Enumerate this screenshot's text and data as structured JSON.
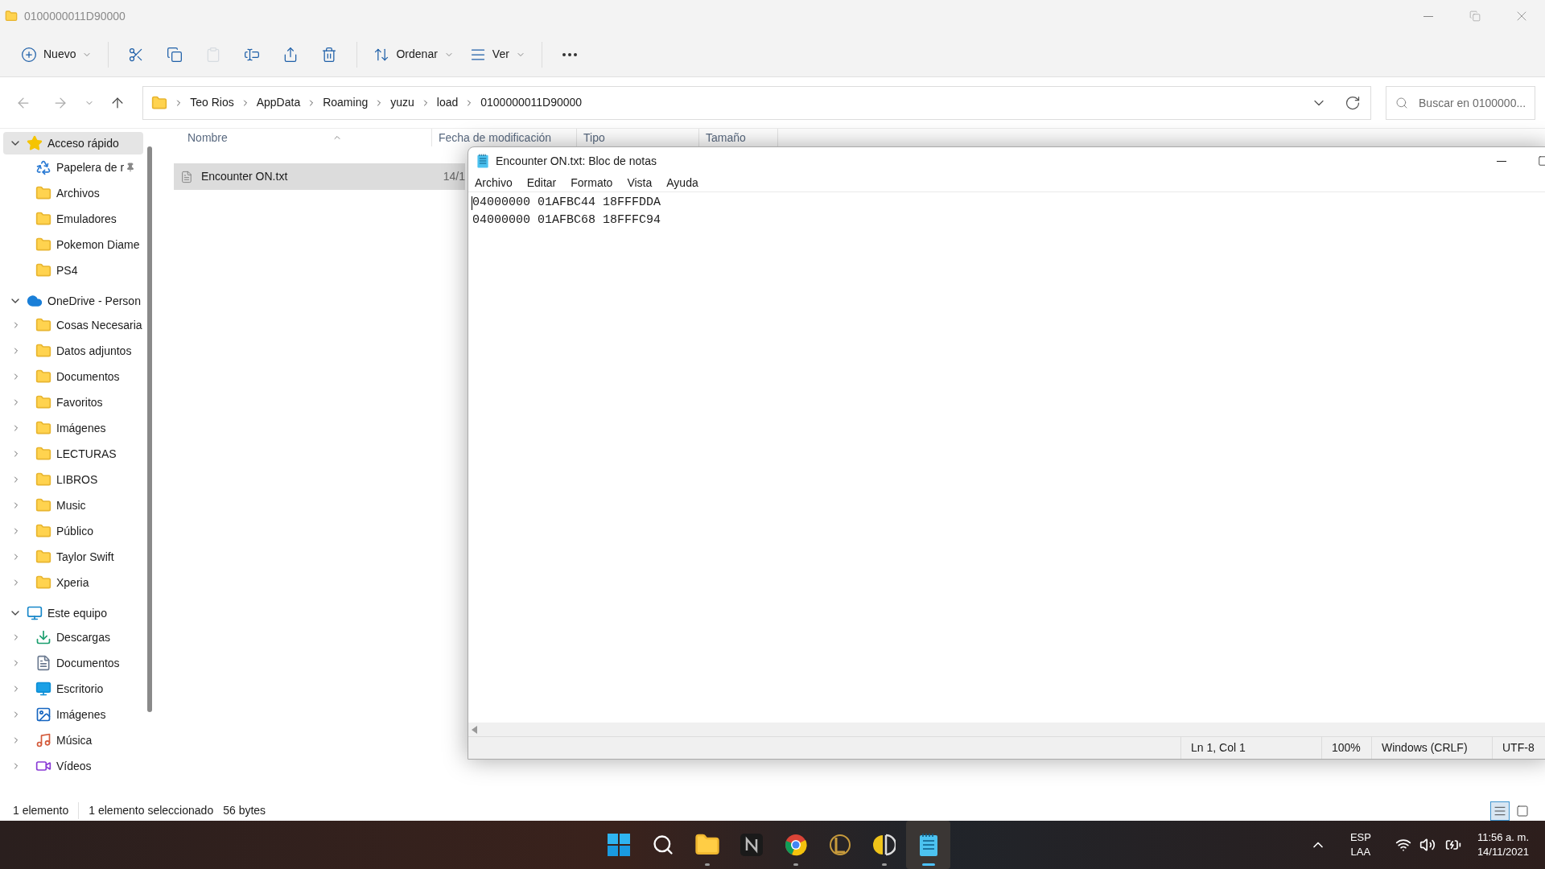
{
  "explorer": {
    "title": "0100000011D90000",
    "toolbar": [
      {
        "kind": "new",
        "label": "Nuevo",
        "disabled": false
      },
      {
        "kind": "cut",
        "disabled": false
      },
      {
        "kind": "copy",
        "disabled": false
      },
      {
        "kind": "paste",
        "disabled": true
      },
      {
        "kind": "rename",
        "disabled": false
      },
      {
        "kind": "share",
        "disabled": false
      },
      {
        "kind": "delete",
        "disabled": false
      },
      {
        "kind": "sort",
        "label": "Ordenar",
        "disabled": false
      },
      {
        "kind": "view",
        "label": "Ver",
        "disabled": false
      },
      {
        "kind": "more",
        "disabled": false
      }
    ],
    "breadcrumbs": [
      "Teo Rios",
      "AppData",
      "Roaming",
      "yuzu",
      "load",
      "0100000011D90000"
    ],
    "search": {
      "placeholder": "Buscar en 0100000..."
    },
    "sidebar": [
      {
        "label": "Acceso rápido",
        "kind": "star",
        "expanded": true,
        "selected": true,
        "children": [
          {
            "label": "Papelera de r",
            "kind": "recycle-bin",
            "pinned": true
          },
          {
            "label": "Archivos",
            "kind": "folder",
            "pinned": false
          },
          {
            "label": "Emuladores",
            "kind": "folder",
            "pinned": false
          },
          {
            "label": "Pokemon Diame",
            "kind": "folder",
            "pinned": false
          },
          {
            "label": "PS4",
            "kind": "folder",
            "pinned": false
          }
        ]
      },
      {
        "label": "OneDrive - Person",
        "kind": "cloud",
        "expanded": true,
        "selected": false,
        "children": [
          {
            "label": "Cosas Necesaria",
            "kind": "folder",
            "expanded": false
          },
          {
            "label": "Datos adjuntos",
            "kind": "folder",
            "expanded": false
          },
          {
            "label": "Documentos",
            "kind": "folder",
            "expanded": false
          },
          {
            "label": "Favoritos",
            "kind": "folder",
            "expanded": false
          },
          {
            "label": "Imágenes",
            "kind": "folder",
            "expanded": false
          },
          {
            "label": "LECTURAS",
            "kind": "folder",
            "expanded": false
          },
          {
            "label": "LIBROS",
            "kind": "folder",
            "expanded": false
          },
          {
            "label": "Music",
            "kind": "folder",
            "expanded": false
          },
          {
            "label": "Público",
            "kind": "folder",
            "expanded": false
          },
          {
            "label": "Taylor Swift",
            "kind": "folder",
            "expanded": false
          },
          {
            "label": "Xperia",
            "kind": "folder",
            "expanded": false
          }
        ]
      },
      {
        "label": "Este equipo",
        "kind": "computer",
        "expanded": true,
        "selected": false,
        "children": [
          {
            "label": "Descargas",
            "kind": "download",
            "expanded": false
          },
          {
            "label": "Documentos",
            "kind": "documents",
            "expanded": false
          },
          {
            "label": "Escritorio",
            "kind": "desktop",
            "expanded": false
          },
          {
            "label": "Imágenes",
            "kind": "pictures",
            "expanded": false
          },
          {
            "label": "Música",
            "kind": "music",
            "expanded": false
          },
          {
            "label": "Vídeos",
            "kind": "videos",
            "expanded": false
          }
        ]
      }
    ],
    "columns": [
      "Nombre",
      "Fecha de modificación",
      "Tipo",
      "Tamaño"
    ],
    "files": [
      {
        "name": "Encounter ON.txt",
        "date": "14/1",
        "selected": true
      }
    ],
    "status_bar": [
      "1 elemento",
      "1 elemento seleccionado",
      "56 bytes"
    ],
    "views": [
      {
        "kind": "details",
        "selected": true
      },
      {
        "kind": "tiles",
        "selected": false
      }
    ]
  },
  "notepad": {
    "title": "Encounter ON.txt: Bloc de notas",
    "menu": [
      "Archivo",
      "Editar",
      "Formato",
      "Vista",
      "Ayuda"
    ],
    "lines": [
      "04000000 01AFBC44 18FFFDDA",
      "04000000 01AFBC68 18FFFC94"
    ],
    "status_bar": [
      "Ln 1, Col 1",
      "100%",
      "Windows (CRLF)",
      "UTF-8"
    ]
  },
  "taskbar": {
    "apps": [
      {
        "kind": "start",
        "running": false,
        "active": false
      },
      {
        "kind": "search",
        "running": false,
        "active": false
      },
      {
        "kind": "explorer",
        "running": true,
        "active": false
      },
      {
        "kind": "n-app",
        "running": false,
        "active": false
      },
      {
        "kind": "browser",
        "running": true,
        "active": false
      },
      {
        "kind": "game",
        "running": false,
        "active": false
      },
      {
        "kind": "half-circle-app",
        "running": true,
        "active": false
      },
      {
        "kind": "notepad",
        "running": true,
        "active": true
      }
    ],
    "language": [
      "ESP",
      "LAA"
    ],
    "time": "11:56 a. m.",
    "date": "14/11/2021"
  }
}
